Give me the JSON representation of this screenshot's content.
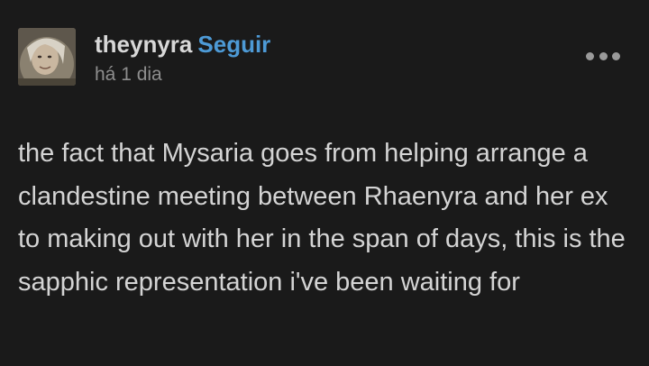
{
  "post": {
    "username": "theynyra",
    "follow_label": "Seguir",
    "timestamp": "há 1 dia",
    "more_icon": "more-horizontal-icon",
    "text": "the fact that Mysaria goes from helping arrange a clandestine meeting between Rhaenyra and her ex to making out with her in the span of days, this is the sapphic representation i've been waiting for"
  },
  "colors": {
    "background": "#1a1a1a",
    "text": "#d4d4d4",
    "follow_accent": "#4d9ad6",
    "muted": "#8e8e8e"
  }
}
